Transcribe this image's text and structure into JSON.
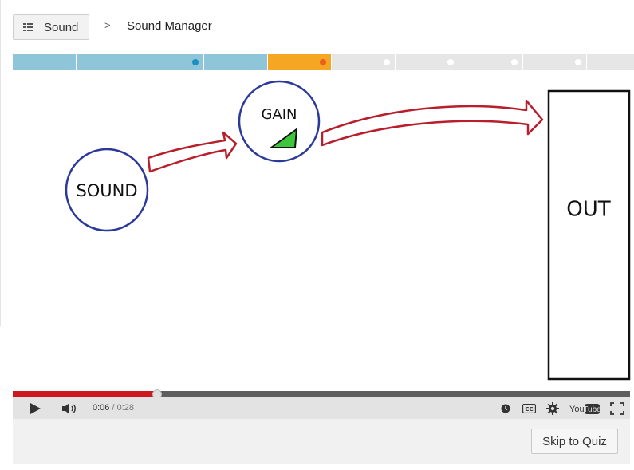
{
  "header": {
    "course_button_label": "Sound",
    "breadcrumb_separator": ">",
    "page_title": "Sound Manager"
  },
  "progress": {
    "segments": [
      {
        "state": "completed",
        "color": "#8ec5d8",
        "dot": false
      },
      {
        "state": "completed",
        "color": "#8ec5d8",
        "dot": false
      },
      {
        "state": "completed",
        "color": "#8ec5d8",
        "dot": true,
        "dot_color": "#1a8fc4"
      },
      {
        "state": "completed",
        "color": "#8ec5d8",
        "dot": false
      },
      {
        "state": "current",
        "color": "#f5a623",
        "dot": true,
        "dot_color": "#e8601c"
      },
      {
        "state": "upcoming",
        "color": "#e6e6e6",
        "dot": true,
        "dot_color": "#ffffff"
      },
      {
        "state": "upcoming",
        "color": "#e6e6e6",
        "dot": true,
        "dot_color": "#ffffff"
      },
      {
        "state": "upcoming",
        "color": "#e6e6e6",
        "dot": true,
        "dot_color": "#ffffff"
      },
      {
        "state": "upcoming",
        "color": "#e6e6e6",
        "dot": true,
        "dot_color": "#ffffff"
      },
      {
        "state": "upcoming",
        "color": "#e6e6e6",
        "dot": false
      }
    ]
  },
  "video": {
    "diagram": {
      "sound_label": "SOUND",
      "gain_label": "GAIN",
      "out_label": "OUT",
      "circle_color": "#2b3a9a",
      "arrow_color": "#b81f2c",
      "gain_fill": "#3cc63c"
    },
    "player": {
      "current_time": "0:06",
      "time_separator": "/",
      "duration": "0:28",
      "played_fraction": 0.234,
      "icons": [
        "play-icon",
        "volume-icon",
        "watch-later-icon",
        "captions-icon",
        "settings-icon",
        "youtube-logo",
        "fullscreen-icon"
      ],
      "captions_label": "CC",
      "logo_text_you": "You",
      "logo_text_tube": "Tube"
    }
  },
  "footer": {
    "skip_button_label": "Skip to Quiz"
  }
}
